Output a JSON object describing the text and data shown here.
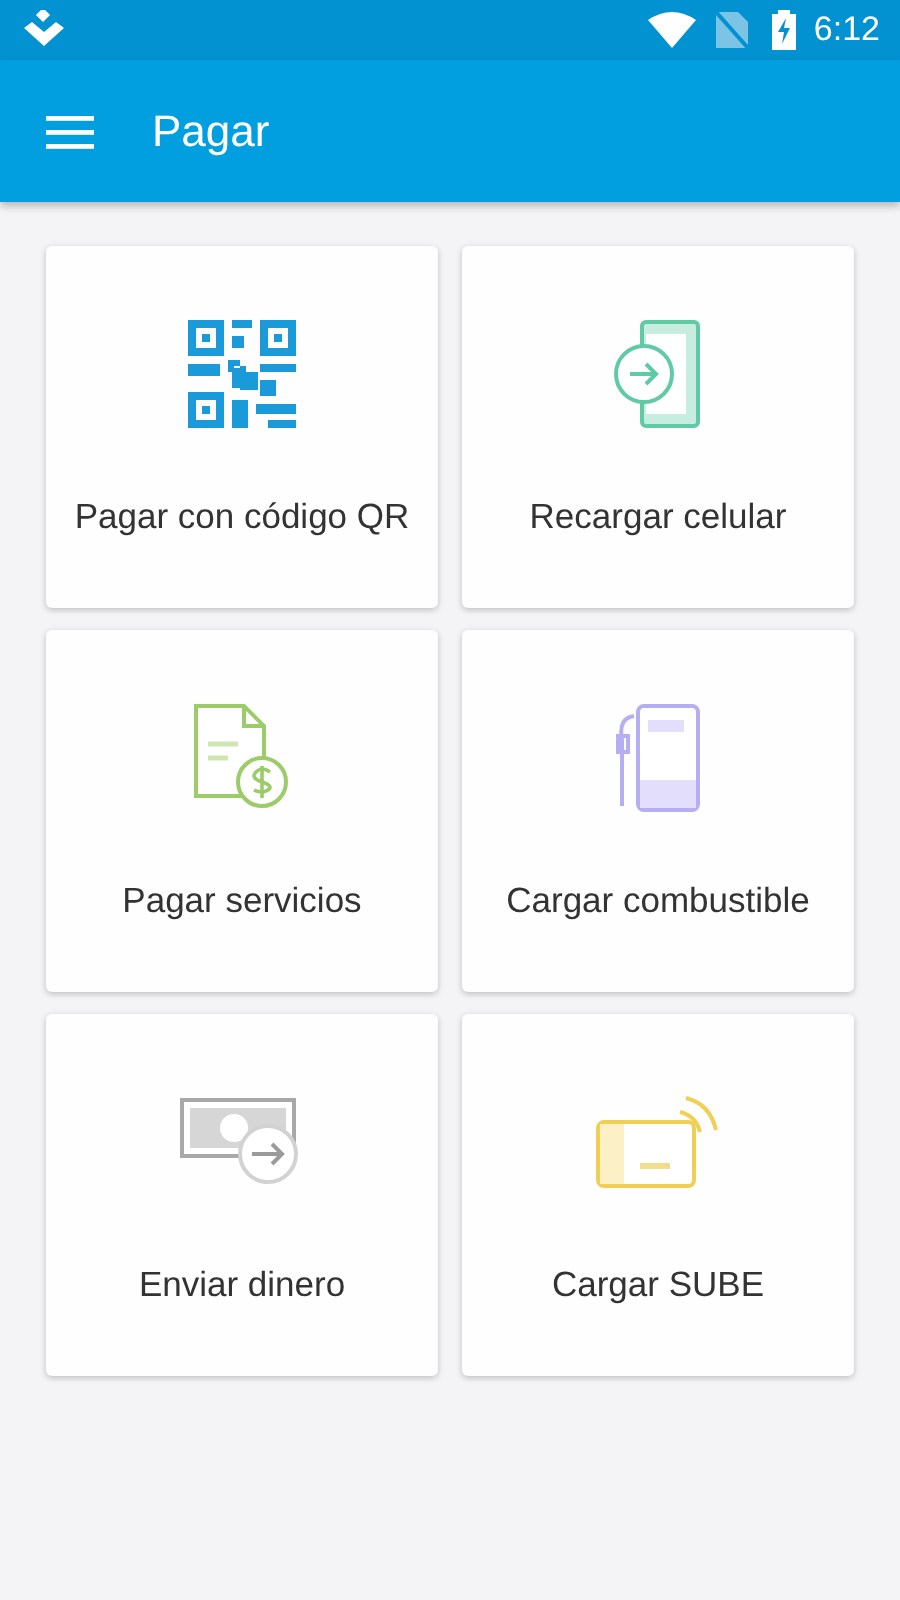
{
  "status_bar": {
    "time": "6:12"
  },
  "app_bar": {
    "title": "Pagar"
  },
  "options": [
    {
      "label": "Pagar con código QR",
      "kind": "qr"
    },
    {
      "label": "Recargar celular",
      "kind": "phone"
    },
    {
      "label": "Pagar servicios",
      "kind": "bill"
    },
    {
      "label": "Cargar combustible",
      "kind": "fuel"
    },
    {
      "label": "Enviar dinero",
      "kind": "money"
    },
    {
      "label": "Cargar SUBE",
      "kind": "card"
    }
  ]
}
